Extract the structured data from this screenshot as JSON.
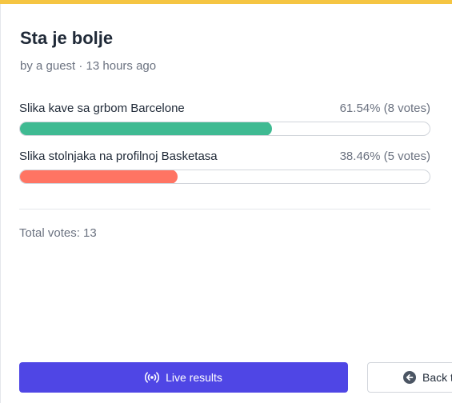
{
  "colors": {
    "top_border": "#f5c542",
    "accent": "#4f46e5",
    "option_colors": [
      "#3fba92",
      "#ff7463"
    ]
  },
  "poll": {
    "title": "Sta je bolje",
    "meta": "by a guest · 13 hours ago",
    "options": [
      {
        "label": "Slika kave sa grbom Barcelone",
        "stats": "61.54% (8 votes)",
        "percent": 61.54
      },
      {
        "label": "Slika stolnjaka na profilnoj Basketasa",
        "stats": "38.46% (5 votes)",
        "percent": 38.46
      }
    ],
    "total": "Total votes: 13"
  },
  "buttons": {
    "live_results": {
      "label": "Live results",
      "icon": "broadcast-icon"
    },
    "back": {
      "label": "Back t",
      "icon": "arrow-left-circle-icon"
    }
  }
}
